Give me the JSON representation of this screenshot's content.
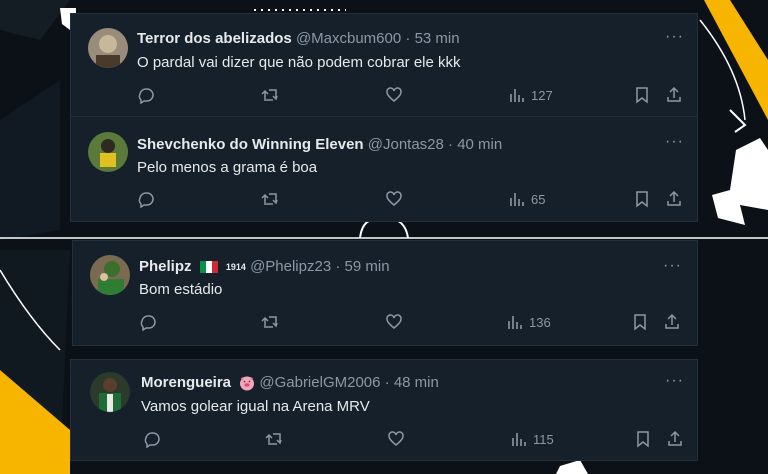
{
  "colors": {
    "card_bg": "#15202b",
    "text": "#e7e9ea",
    "muted": "#8b98a5",
    "accent_yellow": "#f7b500"
  },
  "tweets": [
    {
      "name": "Terror dos abelizados",
      "handle": "@Maxcbum600",
      "time": "53 min",
      "text": "O pardal vai dizer que não podem cobrar ele kkk",
      "views": "127"
    },
    {
      "name": "Shevchenko do Winning Eleven",
      "handle": "@Jontas28",
      "time": "40 min",
      "text": "Pelo menos a grama é boa",
      "views": "65"
    },
    {
      "name": "Phelipz",
      "name_badge": "1914",
      "name_emoji": "italy-flag",
      "handle": "@Phelipz23",
      "time": "59 min",
      "text": "Bom estádio",
      "views": "136"
    },
    {
      "name": "Morengueira",
      "name_emoji": "pig-face",
      "handle": "@GabrielGM2006",
      "time": "48 min",
      "text": "Vamos golear igual na Arena MRV",
      "views": "115"
    }
  ],
  "ui": {
    "separator": "·",
    "more_glyph": "···"
  }
}
